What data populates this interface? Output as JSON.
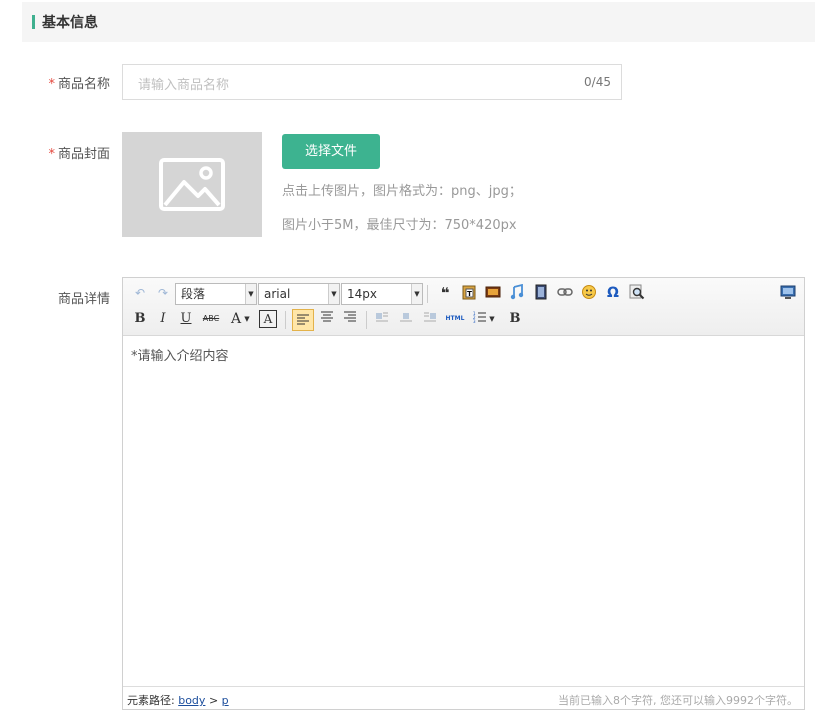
{
  "section": {
    "title": "基本信息"
  },
  "form": {
    "required_mark": "*",
    "name_label": "商品名称",
    "name_placeholder": "请输入商品名称",
    "name_count": "0/45",
    "cover_label": "商品封面",
    "choose_file": "选择文件",
    "hint1": "点击上传图片，图片格式为：png、jpg；",
    "hint2": "图片小于5M，最佳尺寸为：750*420px",
    "detail_label": "商品详情"
  },
  "editor": {
    "paragraph": "段落",
    "font": "arial",
    "size": "14px",
    "bold": "B",
    "italic": "I",
    "underline": "U",
    "strike": "ABC",
    "fontcolor": "A",
    "bgcolor": "A",
    "html": "HTML",
    "bold2": "B",
    "content_placeholder": "*请输入介绍内容",
    "path_label": "元素路径:",
    "path_body": "body",
    "path_sep": ">",
    "path_p": "p",
    "word_count": "当前已输入8个字符, 您还可以输入9992个字符。"
  },
  "colors": {
    "accent": "#3db390",
    "required": "#e4473d"
  }
}
